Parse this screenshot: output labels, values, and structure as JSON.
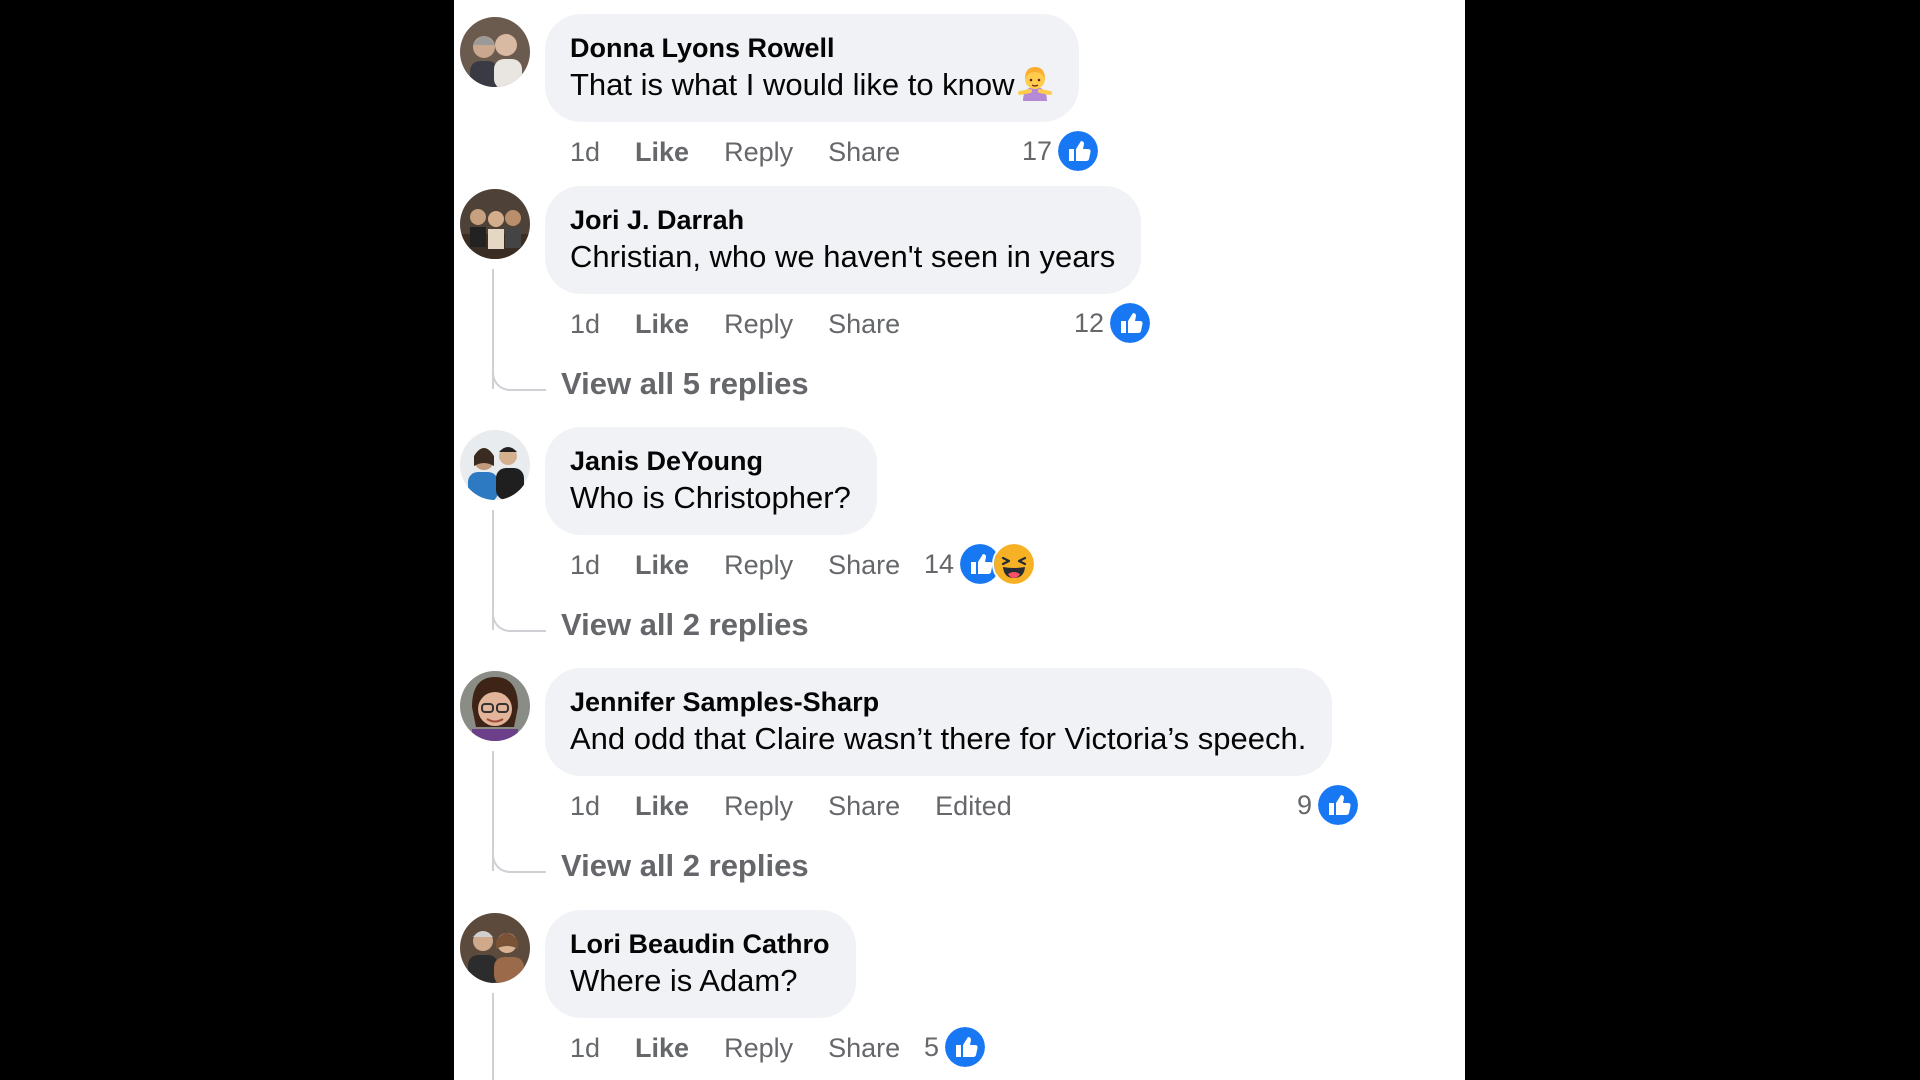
{
  "colors": {
    "background": "#000000",
    "panel": "#ffffff",
    "bubble": "#f0f2f5",
    "text": "#050505",
    "muted": "#65676b",
    "like_blue": "#1877f2",
    "haha_yellow": "#f7b125"
  },
  "comments": [
    {
      "author": "Donna Lyons Rowell",
      "text": "That is what I would like to know",
      "emoji": "woman-gesturing-icon",
      "time": "1d",
      "like": "Like",
      "reply": "Reply",
      "share": "Share",
      "reaction_count": "17",
      "reactions": [
        "like-icon"
      ]
    },
    {
      "author": "Jori J. Darrah",
      "text": "Christian, who we haven't seen in years",
      "time": "1d",
      "like": "Like",
      "reply": "Reply",
      "share": "Share",
      "reaction_count": "12",
      "reactions": [
        "like-icon"
      ],
      "view_replies": "View all 5 replies"
    },
    {
      "author": "Janis DeYoung",
      "text": "Who is Christopher?",
      "time": "1d",
      "like": "Like",
      "reply": "Reply",
      "share": "Share",
      "reaction_count": "14",
      "reactions": [
        "like-icon",
        "haha-icon"
      ],
      "view_replies": "View all 2 replies"
    },
    {
      "author": "Jennifer Samples-Sharp",
      "text": "And odd that Claire wasn’t there for Victoria’s speech.",
      "time": "1d",
      "like": "Like",
      "reply": "Reply",
      "share": "Share",
      "edited": "Edited",
      "reaction_count": "9",
      "reactions": [
        "like-icon"
      ],
      "view_replies": "View all 2 replies"
    },
    {
      "author": "Lori Beaudin Cathro",
      "text": "Where is Adam?",
      "time": "1d",
      "like": "Like",
      "reply": "Reply",
      "share": "Share",
      "reaction_count": "5",
      "reactions": [
        "like-icon"
      ]
    }
  ]
}
